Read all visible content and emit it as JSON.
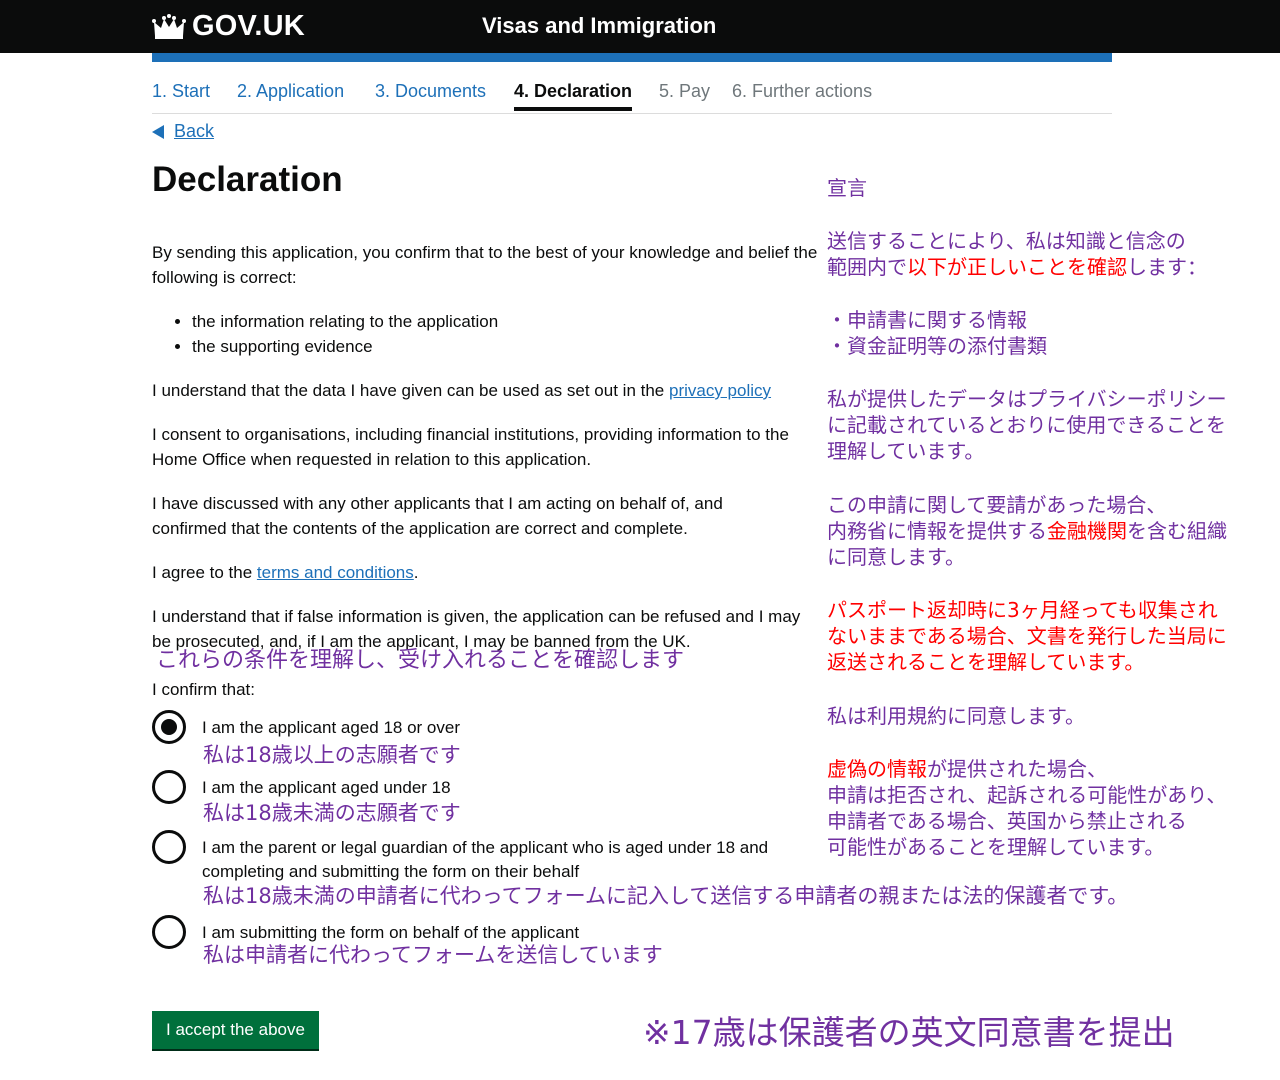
{
  "header": {
    "brand": "GOV.UK",
    "service": "Visas and Immigration",
    "crown_icon": "crown-icon"
  },
  "steps": [
    {
      "label": "1. Start",
      "state": "done"
    },
    {
      "label": "2. Application",
      "state": "done"
    },
    {
      "label": "3. Documents",
      "state": "done"
    },
    {
      "label": "4. Declaration",
      "state": "current"
    },
    {
      "label": "5. Pay",
      "state": "future"
    },
    {
      "label": "6. Further actions",
      "state": "future"
    }
  ],
  "back_label": "Back",
  "title": "Declaration",
  "intro": "By sending this application, you confirm that to the best of your knowledge and belief the following is correct:",
  "bullets": [
    "the information relating to the application",
    "the supporting evidence"
  ],
  "privacy": {
    "text": "I understand that the data I have given can be used as set out in the ",
    "link": "privacy policy"
  },
  "consent": "I consent to organisations, including financial institutions, providing information to the Home Office when requested in relation to this application.",
  "discussed": "I have discussed with any other applicants that I am acting on behalf of, and confirmed that the contents of the application are correct and complete.",
  "terms": {
    "text": "I agree to the ",
    "link": "terms and conditions",
    "after": "."
  },
  "false_info": "I understand that if false information is given, the application can be refused and I may be prosecuted, and, if I am the applicant, I may be banned from the UK.",
  "confirm_label": "I confirm that:",
  "options": [
    {
      "label": "I am the applicant aged 18 or over",
      "checked": true
    },
    {
      "label": "I am the applicant aged under 18",
      "checked": false
    },
    {
      "label": "I am the parent or legal guardian of the applicant who is aged under 18 and completing and submitting the form on their behalf",
      "checked": false
    },
    {
      "label": "I am submitting the form on behalf of the applicant",
      "checked": false
    }
  ],
  "accept_label": "I accept the above",
  "jp": {
    "title": "宣言",
    "intro_1": "送信することにより、私は知識と信念の",
    "intro_2a": "範囲内で",
    "intro_2b": "以下が正しいことを確認",
    "intro_2c": "します：",
    "bullet_1": "・申請書に関する情報",
    "bullet_2": "・資金証明等の添付書類",
    "privacy_1": "私が提供したデータはプライバシーポリシー",
    "privacy_2": "に記載されているとおりに使用できることを",
    "privacy_3": "理解しています。",
    "consent_1": "この申請に関して要請があった場合、",
    "consent_2a": "内務省に情報を提供する",
    "consent_2b": "金融機関",
    "consent_2c": "を含む組織",
    "consent_3": "に同意します。",
    "passport_1": "パスポート返却時に3ヶ月経っても収集され",
    "passport_2": "ないままである場合、文書を発行した当局に",
    "passport_3": "返送されることを理解しています。",
    "terms": "私は利用規約に同意します。",
    "false_1a": "虚偽の情報",
    "false_1b": "が提供された場合、",
    "false_2": "申請は拒否され、起訴される可能性があり、",
    "false_3": "申請者である場合、英国から禁止される",
    "false_4": "可能性があることを理解しています。",
    "confirm": "これらの条件を理解し、受け入れることを確認します",
    "opt_1": "私は18歳以上の志願者です",
    "opt_2": "私は18歳未満の志願者です",
    "opt_3": "私は18歳未満の申請者に代わってフォームに記入して送信する申請者の親または法的保護者です。",
    "opt_4": "私は申請者に代わってフォームを送信しています",
    "note": "※17歳は保護者の英文同意書を提出"
  },
  "colors": {
    "header": "#0b0c0c",
    "blue": "#1d70b8",
    "button": "#00703c",
    "jp_text": "#7030a0",
    "jp_emphasis": "#ff0000"
  }
}
